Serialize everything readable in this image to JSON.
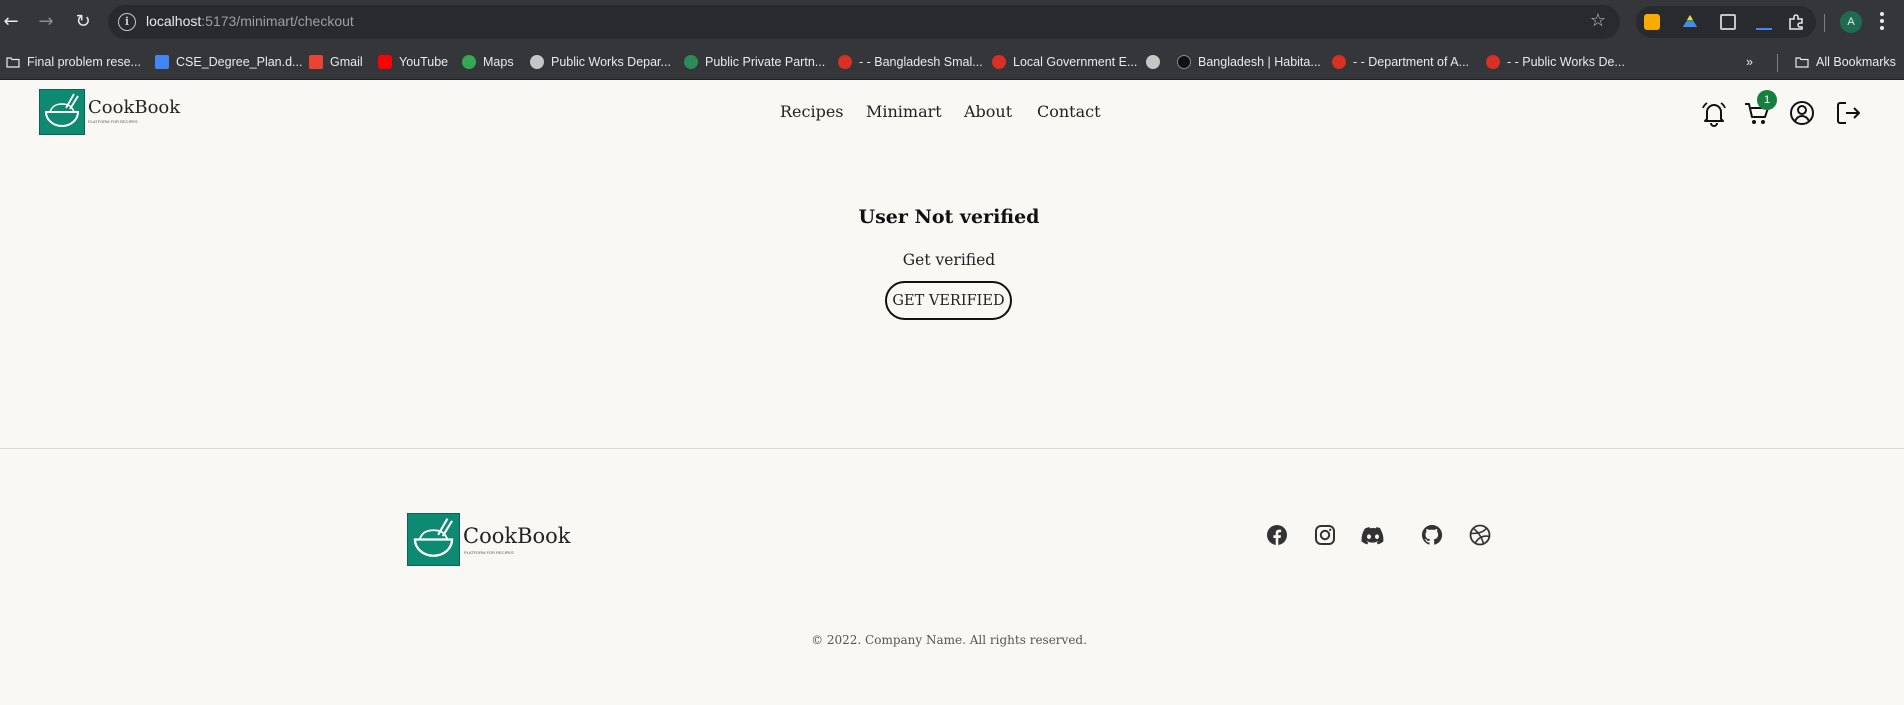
{
  "browser": {
    "url_host": "localhost",
    "url_path": ":5173/minimart/checkout",
    "profile_initial": "A",
    "bookmarks": [
      "Final problem rese...",
      "CSE_Degree_Plan.d...",
      "Gmail",
      "YouTube",
      "Maps",
      "Public Works Depar...",
      "Public Private Partn...",
      "- - Bangladesh Smal...",
      "Local Government E...",
      "Bangladesh | Habita...",
      "- - Department of A...",
      "- - Public Works De..."
    ],
    "all_bookmarks": "All Bookmarks"
  },
  "header": {
    "logo_text": "CookBook",
    "logo_tagline": "PLATFORM FOR RECIPES",
    "nav": [
      "Recipes",
      "Minimart",
      "About",
      "Contact"
    ],
    "cart_count": "1"
  },
  "main": {
    "title": "User Not verified",
    "subtitle": "Get verified",
    "button_label": "GET VERIFIED"
  },
  "footer": {
    "logo_text": "CookBook",
    "logo_tagline": "PLATFORM FOR RECIPES",
    "social_icons": [
      "facebook-icon",
      "instagram-icon",
      "discord-icon",
      "github-icon",
      "dribbble-icon"
    ],
    "copyright": "© 2022. Company Name. All rights reserved."
  },
  "colors": {
    "page_bg": "#faf8f5",
    "brand": "#0e8a73",
    "badge": "#15803d",
    "chrome": "#35363a"
  }
}
